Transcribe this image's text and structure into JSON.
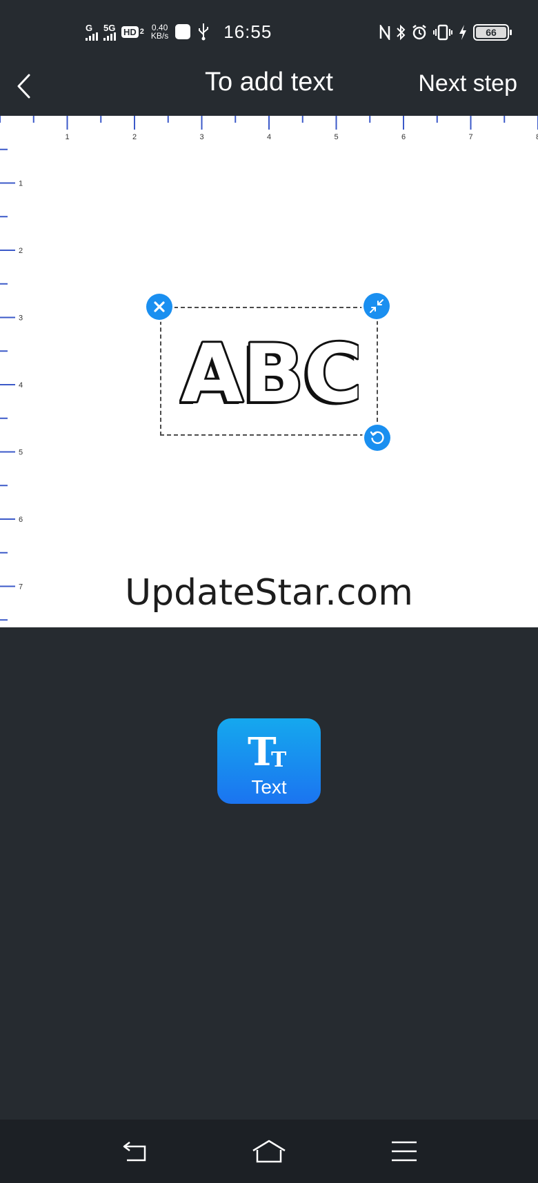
{
  "status_bar": {
    "sim1_network": "G",
    "sim2_network": "5G",
    "hd_label": "HD",
    "hd_sub": "2",
    "net_speed_value": "0.40",
    "net_speed_unit": "KB/s",
    "time": "16:55",
    "battery_level": "66"
  },
  "title_bar": {
    "title": "To add text",
    "next_label": "Next step"
  },
  "ruler": {
    "horizontal_labels": [
      "1",
      "2",
      "3",
      "4",
      "5",
      "6",
      "7",
      "8"
    ],
    "vertical_labels": [
      "1",
      "2",
      "3",
      "4",
      "5",
      "6",
      "7"
    ],
    "color": "#3b59c8"
  },
  "canvas": {
    "sample_text": "ABC",
    "watermark": "UpdateStar.com"
  },
  "toolbar": {
    "text_tool_label": "Text",
    "text_tool_icon_glyph": "Tт"
  },
  "colors": {
    "background": "#262b30",
    "accent": "#1a8ff0",
    "canvas": "#ffffff"
  }
}
